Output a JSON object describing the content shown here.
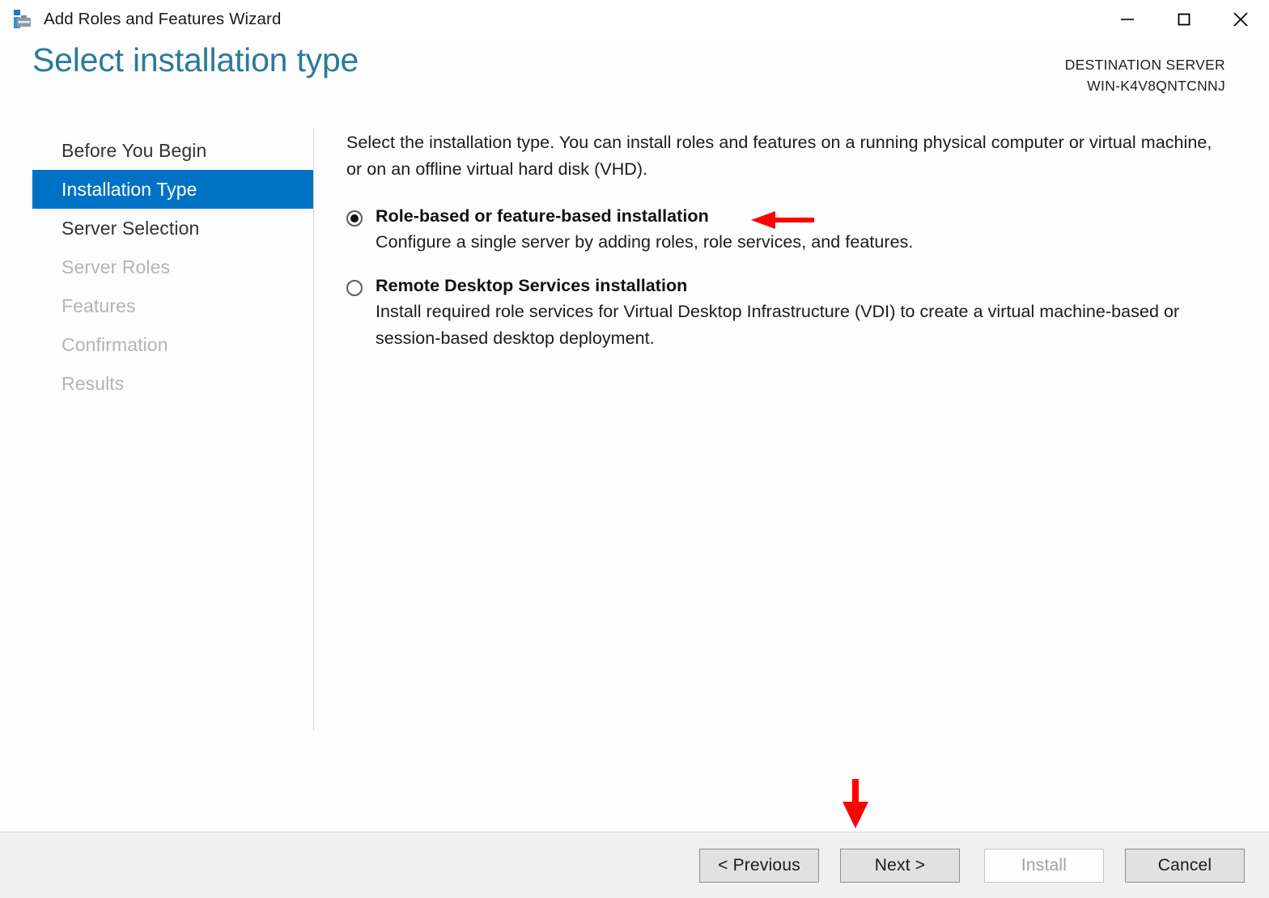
{
  "window": {
    "title": "Add Roles and Features Wizard",
    "icon": "server-tools-icon",
    "controls": {
      "minimize": "minimize-icon",
      "maximize": "maximize-icon",
      "close": "close-icon"
    }
  },
  "header": {
    "page_title": "Select installation type",
    "destination_label": "DESTINATION SERVER",
    "destination_server": "WIN-K4V8QNTCNNJ",
    "title_color": "#2A7B9B"
  },
  "sidebar": {
    "items": [
      {
        "label": "Before You Begin",
        "state": "enabled"
      },
      {
        "label": "Installation Type",
        "state": "selected"
      },
      {
        "label": "Server Selection",
        "state": "enabled"
      },
      {
        "label": "Server Roles",
        "state": "disabled"
      },
      {
        "label": "Features",
        "state": "disabled"
      },
      {
        "label": "Confirmation",
        "state": "disabled"
      },
      {
        "label": "Results",
        "state": "disabled"
      }
    ],
    "selected_color": "#0072C6"
  },
  "main": {
    "intro": "Select the installation type. You can install roles and features on a running physical computer or virtual machine, or on an offline virtual hard disk (VHD).",
    "options": [
      {
        "label": "Role-based or feature-based installation",
        "description": "Configure a single server by adding roles, role services, and features.",
        "checked": true
      },
      {
        "label": "Remote Desktop Services installation",
        "description": "Install required role services for Virtual Desktop Infrastructure (VDI) to create a virtual machine-based or session-based desktop deployment.",
        "checked": false
      }
    ]
  },
  "annotations": {
    "color": "#FF0000",
    "arrow_to_option": "left-arrow-pointing-at-role-based-option",
    "arrow_to_next": "down-arrow-pointing-at-next-button"
  },
  "footer": {
    "buttons": [
      {
        "label": "< Previous",
        "state": "enabled"
      },
      {
        "label": "Next >",
        "state": "enabled"
      },
      {
        "label": "Install",
        "state": "disabled"
      },
      {
        "label": "Cancel",
        "state": "enabled"
      }
    ]
  }
}
